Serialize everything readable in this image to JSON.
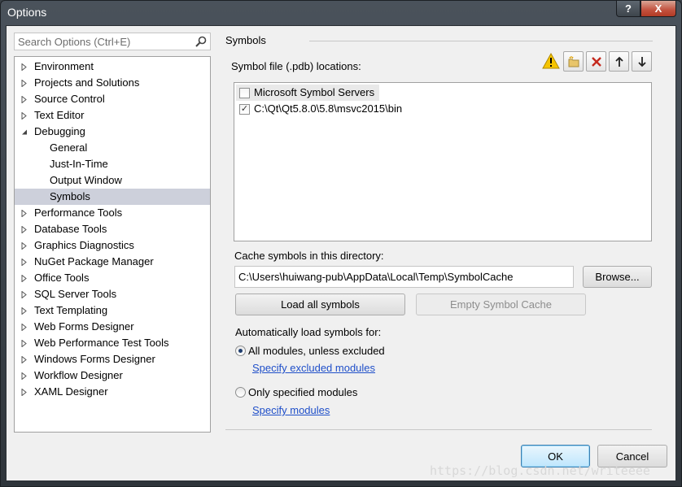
{
  "window": {
    "title": "Options",
    "help_label": "?",
    "close_label": "X"
  },
  "search": {
    "placeholder": "Search Options (Ctrl+E)"
  },
  "tree": {
    "items": [
      {
        "label": "Environment",
        "level": 0,
        "expanded": false
      },
      {
        "label": "Projects and Solutions",
        "level": 0,
        "expanded": false
      },
      {
        "label": "Source Control",
        "level": 0,
        "expanded": false
      },
      {
        "label": "Text Editor",
        "level": 0,
        "expanded": false
      },
      {
        "label": "Debugging",
        "level": 0,
        "expanded": true
      },
      {
        "label": "General",
        "level": 1
      },
      {
        "label": "Just-In-Time",
        "level": 1
      },
      {
        "label": "Output Window",
        "level": 1
      },
      {
        "label": "Symbols",
        "level": 1,
        "selected": true
      },
      {
        "label": "Performance Tools",
        "level": 0,
        "expanded": false
      },
      {
        "label": "Database Tools",
        "level": 0,
        "expanded": false
      },
      {
        "label": "Graphics Diagnostics",
        "level": 0,
        "expanded": false
      },
      {
        "label": "NuGet Package Manager",
        "level": 0,
        "expanded": false
      },
      {
        "label": "Office Tools",
        "level": 0,
        "expanded": false
      },
      {
        "label": "SQL Server Tools",
        "level": 0,
        "expanded": false
      },
      {
        "label": "Text Templating",
        "level": 0,
        "expanded": false
      },
      {
        "label": "Web Forms Designer",
        "level": 0,
        "expanded": false
      },
      {
        "label": "Web Performance Test Tools",
        "level": 0,
        "expanded": false
      },
      {
        "label": "Windows Forms Designer",
        "level": 0,
        "expanded": false
      },
      {
        "label": "Workflow Designer",
        "level": 0,
        "expanded": false
      },
      {
        "label": "XAML Designer",
        "level": 0,
        "expanded": false
      }
    ]
  },
  "symbols": {
    "section_title": "Symbols",
    "locations_label": "Symbol file (.pdb) locations:",
    "toolbar_icons": [
      "warning-icon",
      "new-folder-icon",
      "delete-icon",
      "move-up-icon",
      "move-down-icon"
    ],
    "locations": [
      {
        "label": "Microsoft Symbol Servers",
        "checked": false
      },
      {
        "label": "C:\\Qt\\Qt5.8.0\\5.8\\msvc2015\\bin",
        "checked": true
      }
    ],
    "cache_label": "Cache symbols in this directory:",
    "cache_path": "C:\\Users\\huiwang-pub\\AppData\\Local\\Temp\\SymbolCache",
    "browse_label": "Browse...",
    "load_all_label": "Load all symbols",
    "empty_cache_label": "Empty Symbol Cache",
    "auto_load_label": "Automatically load symbols for:",
    "option_all": "All modules, unless excluded",
    "link_excluded": "Specify excluded modules",
    "option_only": "Only specified modules",
    "link_specify": "Specify modules",
    "selected_option": "all"
  },
  "footer": {
    "ok_label": "OK",
    "cancel_label": "Cancel"
  },
  "watermark": "https://blog.csdn.net/writeeee",
  "colors": {
    "selection": "#cdd0db",
    "link": "#1f4fc9",
    "delete_red": "#c4281c",
    "warning_yellow": "#f5c400"
  }
}
